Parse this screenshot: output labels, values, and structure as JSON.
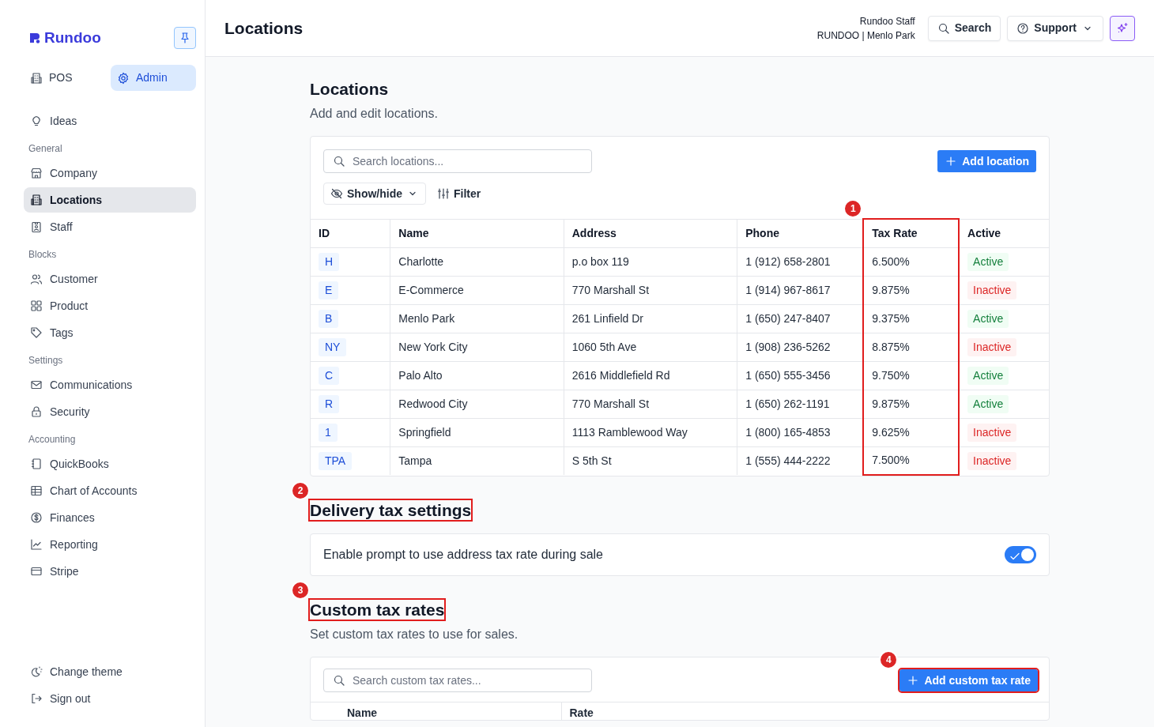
{
  "sidebar": {
    "logo": "Rundoo",
    "modes": [
      {
        "label": "POS",
        "selected": false
      },
      {
        "label": "Admin",
        "selected": true
      }
    ],
    "sections": [
      {
        "items": [
          {
            "label": "Ideas",
            "selected": false
          }
        ]
      },
      {
        "title": "General",
        "items": [
          {
            "label": "Company",
            "selected": false
          },
          {
            "label": "Locations",
            "selected": true
          },
          {
            "label": "Staff",
            "selected": false
          }
        ]
      },
      {
        "title": "Blocks",
        "items": [
          {
            "label": "Customer",
            "selected": false
          },
          {
            "label": "Product",
            "selected": false
          },
          {
            "label": "Tags",
            "selected": false
          }
        ]
      },
      {
        "title": "Settings",
        "items": [
          {
            "label": "Communications",
            "selected": false
          },
          {
            "label": "Security",
            "selected": false
          }
        ]
      },
      {
        "title": "Accounting",
        "items": [
          {
            "label": "QuickBooks",
            "selected": false
          },
          {
            "label": "Chart of Accounts",
            "selected": false
          },
          {
            "label": "Finances",
            "selected": false
          },
          {
            "label": "Reporting",
            "selected": false
          },
          {
            "label": "Stripe",
            "selected": false
          }
        ]
      }
    ],
    "footer": [
      {
        "label": "Change theme"
      },
      {
        "label": "Sign out"
      }
    ]
  },
  "header": {
    "title": "Locations",
    "user_name": "Rundoo Staff",
    "user_org": "RUNDOO | Menlo Park",
    "search_button": "Search",
    "support_button": "Support"
  },
  "locations": {
    "title": "Locations",
    "subtitle": "Add and edit locations.",
    "search": {
      "placeholder": "Search locations..."
    },
    "add_button": "Add location",
    "show_hide": "Show/hide",
    "filter": "Filter",
    "table": {
      "columns": [
        {
          "label": "ID"
        },
        {
          "label": "Name"
        },
        {
          "label": "Address"
        },
        {
          "label": "Phone"
        },
        {
          "label": "Tax Rate",
          "annotation": "1"
        },
        {
          "label": "Active"
        }
      ],
      "rows": [
        {
          "id": "H",
          "name": "Charlotte",
          "address": "p.o box 119",
          "phone": "1 (912) 658-2801",
          "tax_rate": "6.500%",
          "active": true,
          "status": "Active"
        },
        {
          "id": "E",
          "name": "E-Commerce",
          "address": "770 Marshall St",
          "phone": "1 (914) 967-8617",
          "tax_rate": "9.875%",
          "active": false,
          "status": "Inactive"
        },
        {
          "id": "B",
          "name": "Menlo Park",
          "address": "261 Linfield Dr",
          "phone": "1 (650) 247-8407",
          "tax_rate": "9.375%",
          "active": true,
          "status": "Active"
        },
        {
          "id": "NY",
          "name": "New York City",
          "address": "1060 5th Ave",
          "phone": "1 (908) 236-5262",
          "tax_rate": "8.875%",
          "active": false,
          "status": "Inactive"
        },
        {
          "id": "C",
          "name": "Palo Alto",
          "address": "2616 Middlefield Rd",
          "phone": "1 (650) 555-3456",
          "tax_rate": "9.750%",
          "active": true,
          "status": "Active"
        },
        {
          "id": "R",
          "name": "Redwood City",
          "address": "770 Marshall St",
          "phone": "1 (650) 262-1191",
          "tax_rate": "9.875%",
          "active": true,
          "status": "Active"
        },
        {
          "id": "1",
          "name": "Springfield",
          "address": "1113 Ramblewood Way",
          "phone": "1 (800) 165-4853",
          "tax_rate": "9.625%",
          "active": false,
          "status": "Inactive"
        },
        {
          "id": "TPA",
          "name": "Tampa",
          "address": "S 5th St",
          "phone": "1 (555) 444-2222",
          "tax_rate": "7.500%",
          "active": false,
          "status": "Inactive"
        }
      ]
    }
  },
  "delivery_tax": {
    "title": "Delivery tax settings",
    "annotation": "2",
    "setting": {
      "label": "Enable prompt to use address tax rate during sale",
      "on": true
    }
  },
  "custom_tax": {
    "title": "Custom tax rates",
    "annotation": "3",
    "subtitle": "Set custom tax rates to use for sales.",
    "search": {
      "placeholder": "Search custom tax rates..."
    },
    "add_button": {
      "label": "Add custom tax rate",
      "annotation": "4"
    },
    "table": {
      "columns": [
        {
          "label": "Name"
        },
        {
          "label": "Rate"
        }
      ]
    }
  }
}
